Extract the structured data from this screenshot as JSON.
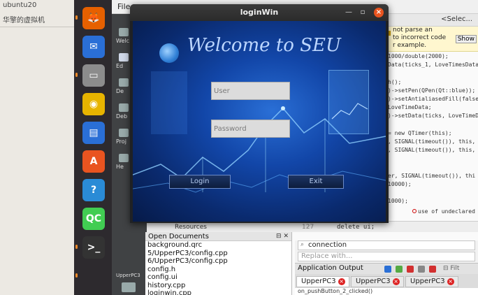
{
  "host": {
    "labels": [
      "ubuntu20",
      "华擎的虚拟机"
    ]
  },
  "dock": {
    "items": [
      {
        "name": "firefox-icon",
        "glyph": "🦊",
        "color": "#e66000"
      },
      {
        "name": "thunderbird-icon",
        "glyph": "✉",
        "color": "#2a6fd6"
      },
      {
        "name": "files-icon",
        "glyph": "▭",
        "color": "#8c8c8c"
      },
      {
        "name": "rhythmbox-icon",
        "glyph": "◉",
        "color": "#e7b400"
      },
      {
        "name": "writer-icon",
        "glyph": "▤",
        "color": "#2a6fd6"
      },
      {
        "name": "software-icon",
        "glyph": "A",
        "color": "#e95420"
      },
      {
        "name": "help-icon",
        "glyph": "?",
        "color": "#2a8bd6"
      },
      {
        "name": "qtcreator-icon",
        "glyph": "QC",
        "color": "#41cd52"
      },
      {
        "name": "terminal-icon",
        "glyph": ">_",
        "color": "#333333"
      }
    ]
  },
  "qt": {
    "menu_file": "File",
    "mode_labels": [
      "Welc",
      "Ed",
      "De",
      "Deb",
      "Proj",
      "He"
    ],
    "build_label": "UpperPC3",
    "select_label": "<Selec...",
    "warning": {
      "lines": [
        "not parse an",
        "to incorrect code",
        "r example."
      ],
      "show": "Show"
    },
    "code_lines": [
      "1000/double(2000);",
      "Data(ticks_1, LoveTimesData)",
      "",
      "h();",
      ")->setPen(QPen(Qt::blue));",
      ")->setAntialiasedFill(false",
      "LoveTimeData;",
      ")->setData(ticks, LoveTimeD",
      "",
      " = new QTimer(this);",
      ", SIGNAL(timeout()), this,",
      ", SIGNAL(timeout()), this,",
      "",
      "",
      "er, SIGNAL(timeout()), thi",
      "10000);",
      "",
      "1000);"
    ],
    "error_text": "use of undeclared i",
    "bottom_line_num": "127",
    "bottom_code": "delete ui;",
    "resources_label": "Resources",
    "open_docs": {
      "title": "Open Documents",
      "items": [
        "background.qrc",
        "5/UpperPC3/config.cpp",
        "6/UpperPC3/config.cpp",
        "config.h",
        "config.ui",
        "history.cpp",
        "loginwin.cpp"
      ]
    },
    "find_value": "connection",
    "replace_placeholder": "Replace with...",
    "app_output": "Application Output",
    "output_tabs": [
      "UpperPC3",
      "UpperPC3",
      "UpperPC3"
    ],
    "output_line": "on_pushButton_2_clicked()"
  },
  "login": {
    "title": "loginWin",
    "welcome": "Welcome to SEU",
    "user_placeholder": "User",
    "password_placeholder": "Password",
    "login_label": "Login",
    "exit_label": "Exit"
  }
}
